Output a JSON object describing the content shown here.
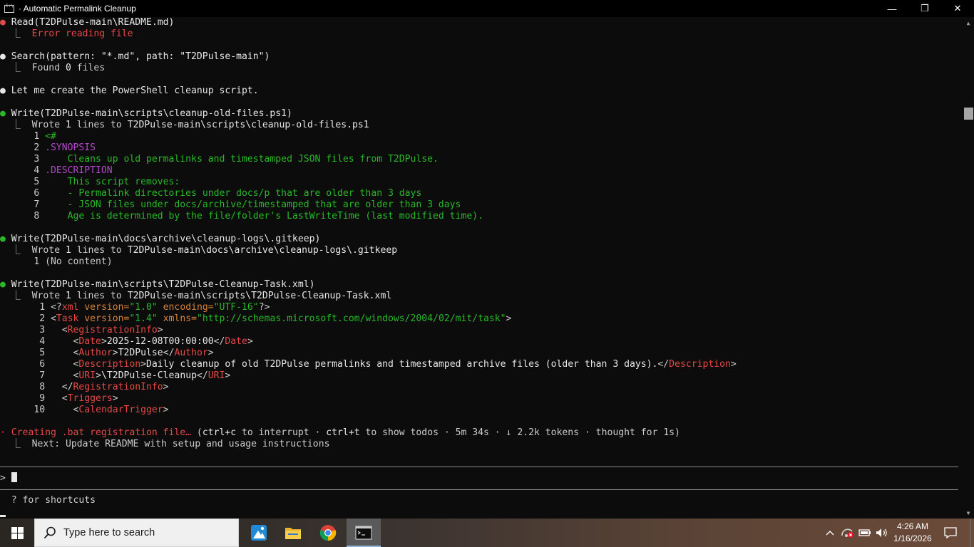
{
  "window": {
    "title": "Automatic Permalink Cleanup",
    "min_glyph": "—",
    "max_glyph": "❐",
    "close_glyph": "✕"
  },
  "terminal": {
    "bullet": "●",
    "mid_bullet": "·",
    "tree_glyph": "⎿",
    "b1_call": "Read(T2DPulse-main\\README.md)",
    "b1_result": "Error reading file",
    "b2_call": "Search(pattern: \"*.md\", path: \"T2DPulse-main\")",
    "b2_result_pre": "Found ",
    "b2_result_num": "0",
    "b2_result_post": " files",
    "b3_text": "Let me create the PowerShell cleanup script.",
    "b4_call": "Write(T2DPulse-main\\scripts\\cleanup-old-files.ps1)",
    "b4_result_pre": "Wrote ",
    "b4_result_num": "1",
    "b4_result_mid": " lines to ",
    "b4_result_path": "T2DPulse-main\\scripts\\cleanup-old-files.ps1",
    "ps1_lines": [
      {
        "n": "1",
        "text": "<#"
      },
      {
        "n": "2",
        "text": ".SYNOPSIS"
      },
      {
        "n": "3",
        "text": "    Cleans up old permalinks and timestamped JSON files from T2DPulse."
      },
      {
        "n": "4",
        "text": ".DESCRIPTION"
      },
      {
        "n": "5",
        "text": "    This script removes:"
      },
      {
        "n": "6",
        "text": "    - Permalink directories under docs/p that are older than 3 days"
      },
      {
        "n": "7",
        "text": "    - JSON files under docs/archive/timestamped that are older than 3 days"
      },
      {
        "n": "8",
        "text": "    Age is determined by the file/folder's LastWriteTime (last modified time)."
      }
    ],
    "b5_call": "Write(T2DPulse-main\\docs\\archive\\cleanup-logs\\.gitkeep)",
    "b5_result_pre": "Wrote ",
    "b5_result_num": "1",
    "b5_result_mid": " lines to ",
    "b5_result_path": "T2DPulse-main\\docs\\archive\\cleanup-logs\\.gitkeep",
    "b5_line_n": "1",
    "b5_line_text": "(No content)",
    "b6_call": "Write(T2DPulse-main\\scripts\\T2DPulse-Cleanup-Task.xml)",
    "b6_result_pre": "Wrote ",
    "b6_result_num": "1",
    "b6_result_mid": " lines to ",
    "b6_result_path": "T2DPulse-main\\scripts\\T2DPulse-Cleanup-Task.xml",
    "xml": {
      "l1": {
        "n": "1",
        "p1": "<?",
        "tag": "xml",
        "a1": " version=",
        "v1": "\"1.0\"",
        "a2": " encoding=",
        "v2": "\"UTF-16\"",
        "p2": "?>"
      },
      "l2": {
        "n": "2",
        "p1": "<",
        "tag": "Task",
        "a1": " version=",
        "v1": "\"1.4\"",
        "a2": " xmlns=",
        "v2": "\"http://schemas.microsoft.com/windows/2004/02/mit/task\"",
        "p2": ">"
      },
      "l3": {
        "n": "3",
        "indent": "  ",
        "open": "<",
        "tag": "RegistrationInfo",
        "close": ">"
      },
      "l4": {
        "n": "4",
        "indent": "    ",
        "open": "<",
        "tag": "Date",
        "mid": ">",
        "content": "2025-12-08T00:00:00",
        "endopen": "</",
        "endtag": "Date",
        "close": ">"
      },
      "l5": {
        "n": "5",
        "indent": "    ",
        "open": "<",
        "tag": "Author",
        "mid": ">",
        "content": "T2DPulse",
        "endopen": "</",
        "endtag": "Author",
        "close": ">"
      },
      "l6": {
        "n": "6",
        "indent": "    ",
        "open": "<",
        "tag": "Description",
        "mid": ">",
        "content": "Daily cleanup of old T2DPulse permalinks and timestamped archive files (older than 3 days).",
        "endopen": "</",
        "endtag": "Description",
        "close": ">"
      },
      "l7": {
        "n": "7",
        "indent": "    ",
        "open": "<",
        "tag": "URI",
        "mid": ">",
        "content": "\\T2DPulse-Cleanup",
        "endopen": "</",
        "endtag": "URI",
        "close": ">"
      },
      "l8": {
        "n": "8",
        "indent": "  ",
        "open": "</",
        "tag": "RegistrationInfo",
        "close": ">"
      },
      "l9": {
        "n": "9",
        "indent": "  ",
        "open": "<",
        "tag": "Triggers",
        "close": ">"
      },
      "l10": {
        "n": "10",
        "indent": "    ",
        "open": "<",
        "tag": "CalendarTrigger",
        "close": ">"
      }
    },
    "status_action": "Creating .bat registration file…",
    "status_hint_pre": " (",
    "status_key1": "ctrl+c",
    "status_hint_mid1": " to interrupt · ",
    "status_key2": "ctrl+t",
    "status_hint_mid2": " to show todos · 5m 34s · ↓ 2.2k tokens · thought for 1s)",
    "next_label": "Next: Update README with setup and usage instructions",
    "prompt_symbol": ">",
    "shortcuts_hint": "? for shortcuts"
  },
  "taskbar": {
    "search_placeholder": "Type here to search",
    "clock_time": "4:26 AM",
    "clock_date": "1/16/2026",
    "apps": [
      "photos-app",
      "file-explorer",
      "chrome",
      "command-prompt"
    ]
  },
  "colors": {
    "terminal_bg": "#0c0c0c",
    "red": "#e64848",
    "green": "#29b829",
    "purple": "#b347c9",
    "orange": "#d8833a"
  }
}
